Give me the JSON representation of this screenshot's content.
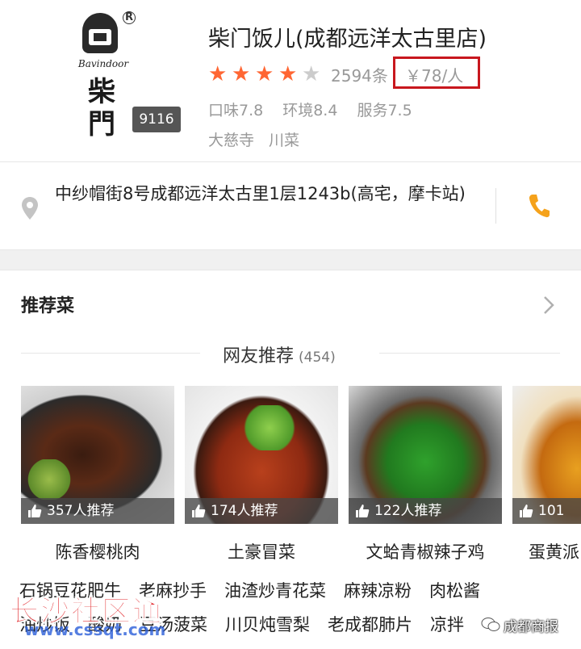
{
  "header": {
    "logo": {
      "reg_mark": "R",
      "brand_en": "Bavindoor",
      "brand_cn": "柴門"
    },
    "photo_count": "9116",
    "shop_name": "柴门饭儿(成都远洋太古里店)",
    "rating_stars": 4,
    "rating_max": 5,
    "review_count": "2594条",
    "price": "￥78/人",
    "scores": {
      "taste": "口味7.8",
      "environment": "环境8.4",
      "service": "服务7.5"
    },
    "tags": [
      "大慈寺",
      "川菜"
    ]
  },
  "address": {
    "text": "中纱帽街8号成都远洋太古里1层1243b(高宅，摩卡站)"
  },
  "recommend": {
    "title": "推荐菜",
    "net_title": "网友推荐",
    "net_count": "(454)",
    "dishes": [
      {
        "name": "陈香樱桃肉",
        "count": "357人推荐"
      },
      {
        "name": "土豪冒菜",
        "count": "174人推荐"
      },
      {
        "name": "文蛤青椒辣子鸡",
        "count": "122人推荐"
      },
      {
        "name": "蛋黄派",
        "count": "101"
      }
    ],
    "more_row1": [
      "石锅豆花肥牛",
      "老麻抄手",
      "油渣炒青花菜",
      "麻辣凉粉",
      "肉松酱"
    ],
    "more_row2": [
      "油炒饭",
      "酸奶",
      "豆汤菠菜",
      "川贝炖雪梨",
      "老成都肺片",
      "凉拌"
    ]
  },
  "watermarks": {
    "left_main": "长沙社区通",
    "left_url": "www.cssqt.com",
    "right_text": "成都商报"
  },
  "colors": {
    "star_on": "#ff6633",
    "star_off": "#cccccc",
    "price_box": "#c8171e",
    "phone_icon": "#f5a21b",
    "watermark_red": "#e0181d"
  }
}
